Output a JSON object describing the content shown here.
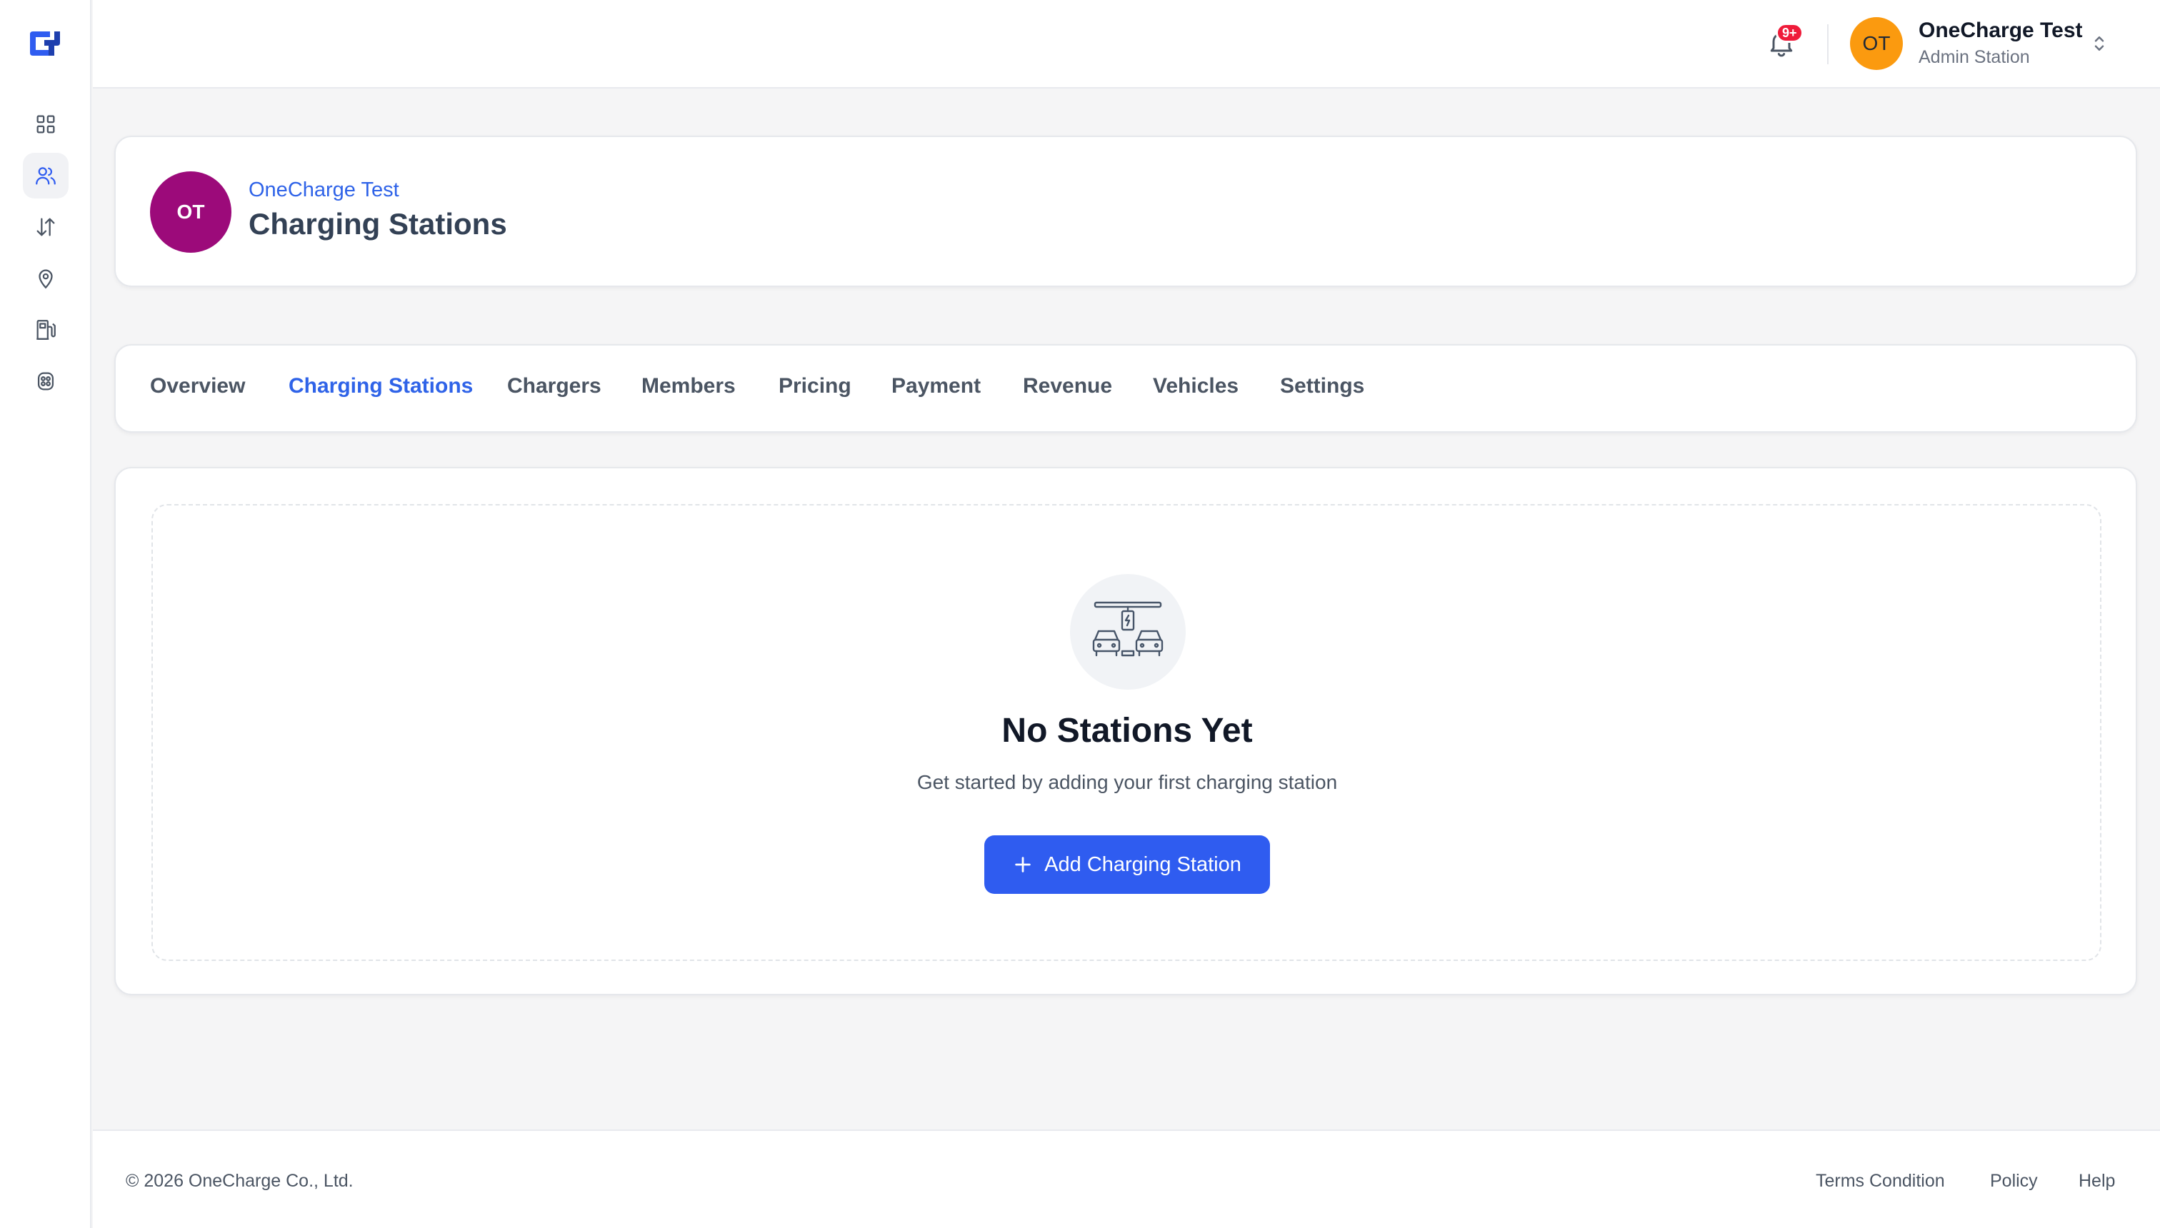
{
  "sidebar": {
    "items": [
      {
        "icon": "grid-icon"
      },
      {
        "icon": "users-icon",
        "active": true
      },
      {
        "icon": "arrows-up-down-icon"
      },
      {
        "icon": "map-pin-icon"
      },
      {
        "icon": "fuel-station-icon"
      },
      {
        "icon": "ev-plug-icon"
      }
    ]
  },
  "topbar": {
    "notification_badge": "9+",
    "user": {
      "initials": "OT",
      "name": "OneCharge Test",
      "role": "Admin Station"
    }
  },
  "header": {
    "avatar_initials": "OT",
    "org_name": "OneCharge Test",
    "title": "Charging Stations"
  },
  "tabs": [
    {
      "label": "Overview"
    },
    {
      "label": "Charging Stations",
      "active": true
    },
    {
      "label": "Chargers"
    },
    {
      "label": "Members"
    },
    {
      "label": "Pricing"
    },
    {
      "label": "Payment"
    },
    {
      "label": "Revenue"
    },
    {
      "label": "Vehicles"
    },
    {
      "label": "Settings"
    }
  ],
  "empty_state": {
    "icon": "charging-station-icon",
    "title": "No Stations Yet",
    "subtitle": "Get started by adding your first charging station",
    "button_label": "Add Charging Station"
  },
  "footer": {
    "copyright": "© 2026 OneCharge Co., Ltd.",
    "links": [
      "Terms Condition",
      "Policy",
      "Help"
    ]
  },
  "colors": {
    "accent": "#2f5cf0",
    "link": "#2f63e8",
    "org_avatar": "#9c0a7a",
    "user_avatar": "#fb9a0f",
    "badge": "#ef1b3a"
  }
}
